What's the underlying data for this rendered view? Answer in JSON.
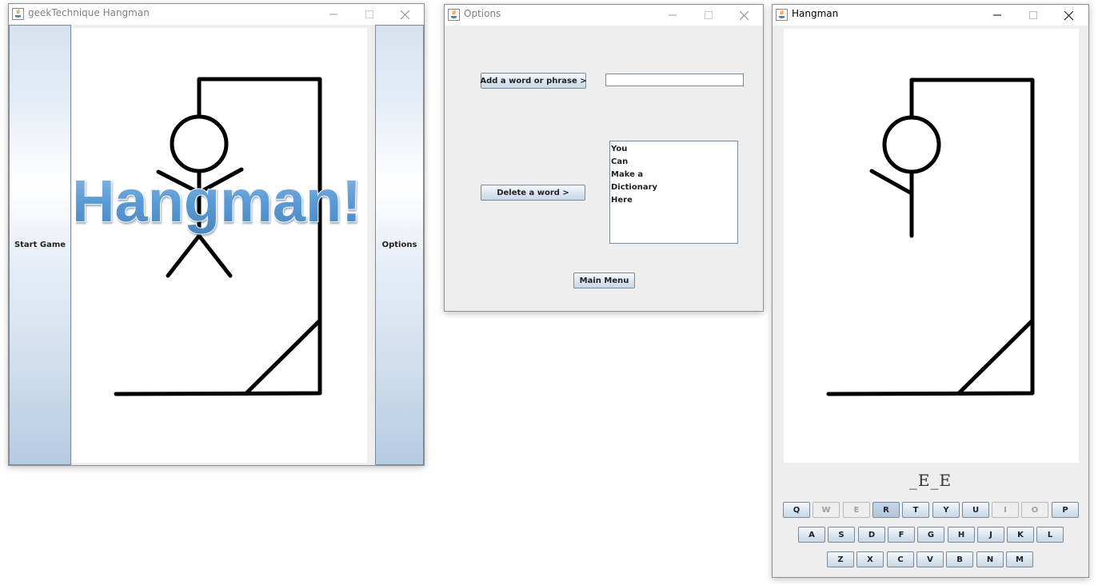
{
  "splash_window": {
    "title": "geekTechnique Hangman",
    "start_button": "Start Game",
    "options_button": "Options",
    "logo_text": "Hangman!"
  },
  "options_window": {
    "title": "Options",
    "add_button": "Add a word or phrase >",
    "add_input_value": "",
    "delete_button": "Delete a word >",
    "dictionary": [
      "You",
      "Can",
      "Make a",
      "Dictionary",
      "Here"
    ],
    "main_menu_button": "Main Menu"
  },
  "game_window": {
    "title": "Hangman",
    "word_display": "_E_E",
    "keyboard_rows": [
      [
        "Q",
        "W",
        "E",
        "R",
        "T",
        "Y",
        "U",
        "I",
        "O",
        "P"
      ],
      [
        "A",
        "S",
        "D",
        "F",
        "G",
        "H",
        "J",
        "K",
        "L"
      ],
      [
        "Z",
        "X",
        "C",
        "V",
        "B",
        "N",
        "M"
      ]
    ],
    "used_letters": [
      "W",
      "E",
      "I",
      "O"
    ],
    "pressed_letter": "R"
  },
  "colors": {
    "logo_fill": "#5b9bd5",
    "button_top": "#f4f8fc",
    "button_bottom": "#c8d7e8",
    "gallows": "#000000"
  }
}
